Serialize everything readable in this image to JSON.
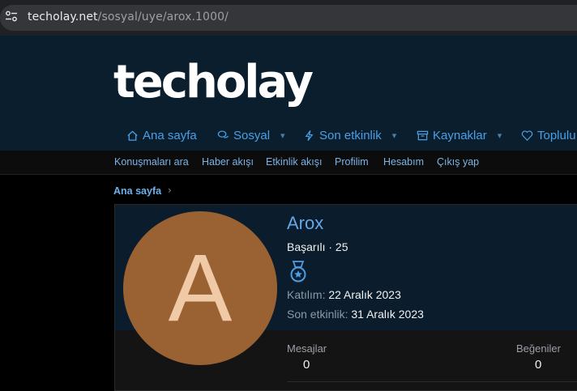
{
  "browser": {
    "url_host": "techolay.net",
    "url_path": "/sosyal/uye/arox.1000/"
  },
  "site": {
    "logo": "techolay"
  },
  "nav": {
    "tabs": [
      {
        "label": "Ana sayfa",
        "icon": "home-icon"
      },
      {
        "label": "Sosyal",
        "icon": "chat-icon",
        "caret": "▾"
      },
      {
        "label": "Son etkinlik",
        "icon": "bolt-icon",
        "caret": "▾"
      },
      {
        "label": "Kaynaklar",
        "icon": "archive-icon",
        "caret": "▾"
      },
      {
        "label": "Toplulu",
        "icon": "heart-icon"
      }
    ],
    "sub_links": [
      "Konuşmaları ara",
      "Haber akışı",
      "Etkinlik akışı",
      "Profilim",
      "Hesabım",
      "Çıkış yap"
    ]
  },
  "breadcrumb": {
    "label": "Ana sayfa",
    "chevron": "›"
  },
  "profile": {
    "avatar_letter": "A",
    "username": "Arox",
    "rank": "Başarılı · 25",
    "badge_icon": "medal-star-icon",
    "joined_label": "Katılım:",
    "joined_value": "22 Aralık 2023",
    "last_seen_label": "Son etkinlik:",
    "last_seen_value": "31 Aralık 2023",
    "stats": [
      {
        "label": "Mesajlar",
        "value": "0"
      },
      {
        "label": "Beğeniler",
        "value": "0"
      }
    ]
  },
  "colors": {
    "header_bg": "#0b1e2e",
    "link": "#4a9fe5",
    "avatar_bg": "#9a6233"
  }
}
